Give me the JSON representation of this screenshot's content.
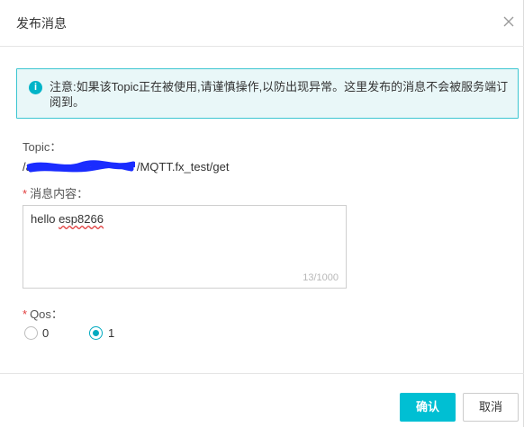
{
  "dialog": {
    "title": "发布消息",
    "close_icon": "close-icon"
  },
  "notice": {
    "icon": "info-icon",
    "icon_glyph": "i",
    "text": "注意:如果该Topic正在被使用,请谨慎操作,以防出现异常。这里发布的消息不会被服务端订阅到。"
  },
  "form": {
    "topic": {
      "label": "Topic：",
      "value_prefix": "/a",
      "value_suffix": "/MQTT.fx_test/get"
    },
    "message": {
      "label": "消息内容：",
      "value": "hello esp8266",
      "value_plain": "hello ",
      "value_misspelled": "esp8266",
      "counter": "13/1000"
    },
    "qos": {
      "label": "Qos：",
      "options": [
        {
          "label": "0",
          "checked": false
        },
        {
          "label": "1",
          "checked": true
        }
      ]
    }
  },
  "footer": {
    "confirm_label": "确认",
    "cancel_label": "取消"
  },
  "colors": {
    "accent": "#00bfd3",
    "notice_border": "#3cc6d1",
    "notice_bg": "#e9f7f8",
    "required": "#e13d3d",
    "redaction": "#1a2cff"
  }
}
